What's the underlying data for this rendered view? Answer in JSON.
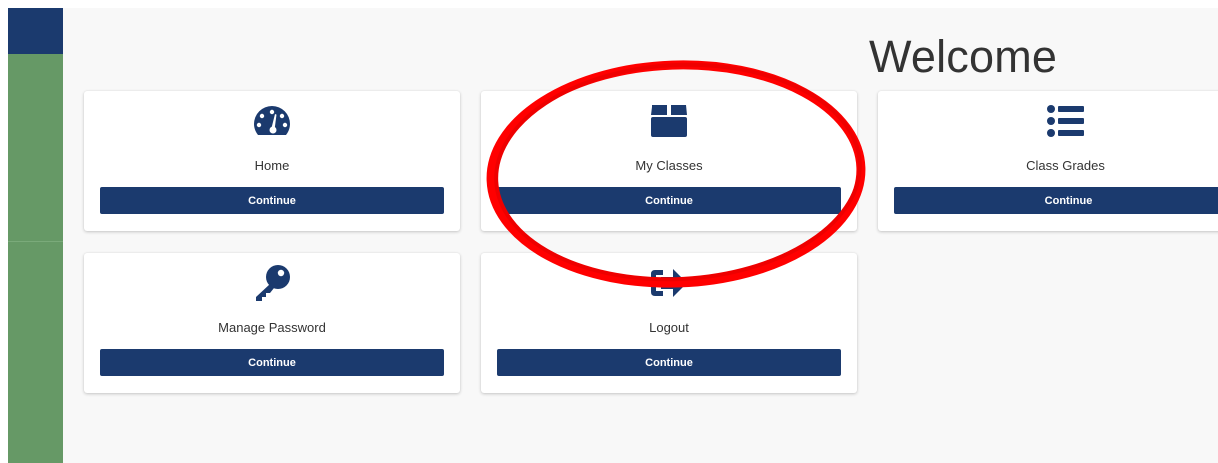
{
  "page": {
    "title": "Welcome"
  },
  "cards": [
    {
      "label": "Home",
      "icon": "dashboard-icon",
      "button": "Continue"
    },
    {
      "label": "My Classes",
      "icon": "box-icon",
      "button": "Continue"
    },
    {
      "label": "Class Grades",
      "icon": "list-icon",
      "button": "Continue"
    },
    {
      "label": "Manage Password",
      "icon": "key-icon",
      "button": "Continue"
    },
    {
      "label": "Logout",
      "icon": "sign-out-icon",
      "button": "Continue"
    }
  ],
  "colors": {
    "navy": "#1b3a6e",
    "sidebar_green": "#669966",
    "annotation_red": "#ff0000"
  }
}
